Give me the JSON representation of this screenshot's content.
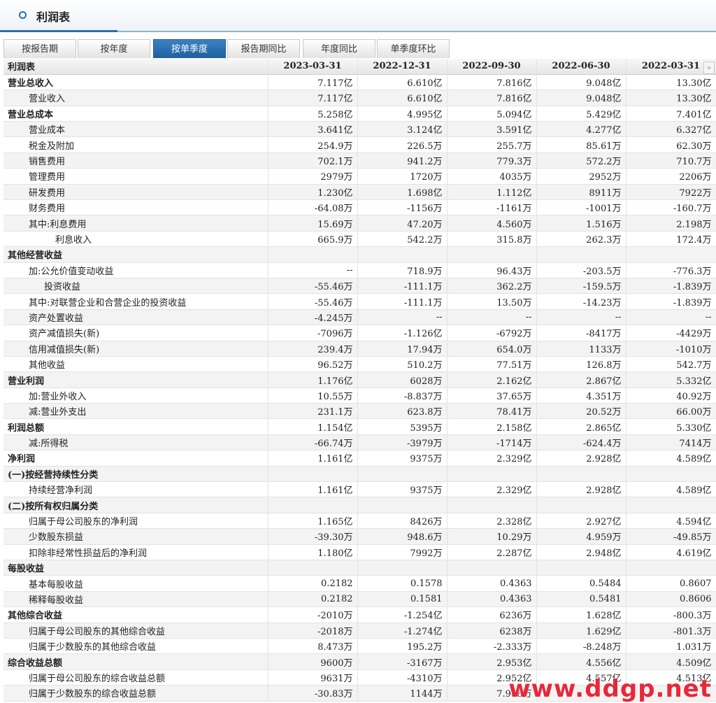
{
  "header": {
    "title": "利润表"
  },
  "tabs": [
    "按报告期",
    "按年度",
    "按单季度",
    "报告期同比",
    "年度同比",
    "单季度环比"
  ],
  "active_tab": 2,
  "columns": [
    "利润表",
    "2023-03-31",
    "2022-12-31",
    "2022-09-30",
    "2022-06-30",
    "2022-03-31"
  ],
  "rows": [
    {
      "label": "营业总收入",
      "level": 0,
      "values": [
        "7.117亿",
        "6.610亿",
        "7.816亿",
        "9.048亿",
        "13.30亿"
      ]
    },
    {
      "label": "营业收入",
      "level": 1,
      "values": [
        "7.117亿",
        "6.610亿",
        "7.816亿",
        "9.048亿",
        "13.30亿"
      ]
    },
    {
      "label": "营业总成本",
      "level": 0,
      "values": [
        "5.258亿",
        "4.995亿",
        "5.094亿",
        "5.429亿",
        "7.401亿"
      ]
    },
    {
      "label": "营业成本",
      "level": 1,
      "values": [
        "3.641亿",
        "3.124亿",
        "3.591亿",
        "4.277亿",
        "6.327亿"
      ]
    },
    {
      "label": "税金及附加",
      "level": 1,
      "values": [
        "254.9万",
        "226.5万",
        "255.7万",
        "85.61万",
        "62.30万"
      ]
    },
    {
      "label": "销售费用",
      "level": 1,
      "values": [
        "702.1万",
        "941.2万",
        "779.3万",
        "572.2万",
        "710.7万"
      ]
    },
    {
      "label": "管理费用",
      "level": 1,
      "values": [
        "2979万",
        "1720万",
        "4035万",
        "2952万",
        "2206万"
      ]
    },
    {
      "label": "研发费用",
      "level": 1,
      "values": [
        "1.230亿",
        "1.698亿",
        "1.112亿",
        "8911万",
        "7922万"
      ]
    },
    {
      "label": "财务费用",
      "level": 1,
      "values": [
        "-64.08万",
        "-1156万",
        "-1161万",
        "-1001万",
        "-160.7万"
      ]
    },
    {
      "label": "其中:利息费用",
      "level": 1,
      "values": [
        "15.69万",
        "47.20万",
        "4.560万",
        "1.516万",
        "2.198万"
      ]
    },
    {
      "label": "利息收入",
      "level": 3,
      "values": [
        "665.9万",
        "542.2万",
        "315.8万",
        "262.3万",
        "172.4万"
      ]
    },
    {
      "label": "其他经营收益",
      "level": 0,
      "values": [
        "",
        "",
        "",
        "",
        ""
      ]
    },
    {
      "label": "加:公允价值变动收益",
      "level": 1,
      "values": [
        "--",
        "718.9万",
        "96.43万",
        "-203.5万",
        "-776.3万"
      ]
    },
    {
      "label": "投资收益",
      "level": 2,
      "values": [
        "-55.46万",
        "-111.1万",
        "362.2万",
        "-159.5万",
        "-1.839万"
      ]
    },
    {
      "label": "其中:对联营企业和合营企业的投资收益",
      "level": 1,
      "values": [
        "-55.46万",
        "-111.1万",
        "13.50万",
        "-14.23万",
        "-1.839万"
      ]
    },
    {
      "label": "资产处置收益",
      "level": 1,
      "values": [
        "-4.245万",
        "--",
        "--",
        "--",
        "--"
      ]
    },
    {
      "label": "资产减值损失(新)",
      "level": 1,
      "values": [
        "-7096万",
        "-1.126亿",
        "-6792万",
        "-8417万",
        "-4429万"
      ]
    },
    {
      "label": "信用减值损失(新)",
      "level": 1,
      "values": [
        "239.4万",
        "17.94万",
        "654.0万",
        "1133万",
        "-1010万"
      ]
    },
    {
      "label": "其他收益",
      "level": 1,
      "values": [
        "96.52万",
        "510.2万",
        "77.51万",
        "126.8万",
        "542.7万"
      ]
    },
    {
      "label": "营业利润",
      "level": 0,
      "values": [
        "1.176亿",
        "6028万",
        "2.162亿",
        "2.867亿",
        "5.332亿"
      ]
    },
    {
      "label": "加:营业外收入",
      "level": 1,
      "values": [
        "10.55万",
        "-8.837万",
        "37.65万",
        "4.351万",
        "40.92万"
      ]
    },
    {
      "label": "减:营业外支出",
      "level": 1,
      "values": [
        "231.1万",
        "623.8万",
        "78.41万",
        "20.52万",
        "66.00万"
      ]
    },
    {
      "label": "利润总额",
      "level": 0,
      "values": [
        "1.154亿",
        "5395万",
        "2.158亿",
        "2.865亿",
        "5.330亿"
      ]
    },
    {
      "label": "减:所得税",
      "level": 1,
      "values": [
        "-66.74万",
        "-3979万",
        "-1714万",
        "-624.4万",
        "7414万"
      ]
    },
    {
      "label": "净利润",
      "level": 0,
      "values": [
        "1.161亿",
        "9375万",
        "2.329亿",
        "2.928亿",
        "4.589亿"
      ]
    },
    {
      "label": "(一)按经营持续性分类",
      "level": 0,
      "values": [
        "",
        "",
        "",
        "",
        ""
      ]
    },
    {
      "label": "持续经营净利润",
      "level": 1,
      "values": [
        "1.161亿",
        "9375万",
        "2.329亿",
        "2.928亿",
        "4.589亿"
      ]
    },
    {
      "label": "(二)按所有权归属分类",
      "level": 0,
      "values": [
        "",
        "",
        "",
        "",
        ""
      ]
    },
    {
      "label": "归属于母公司股东的净利润",
      "level": 1,
      "values": [
        "1.165亿",
        "8426万",
        "2.328亿",
        "2.927亿",
        "4.594亿"
      ]
    },
    {
      "label": "少数股东损益",
      "level": 1,
      "values": [
        "-39.30万",
        "948.6万",
        "10.29万",
        "4.959万",
        "-49.85万"
      ]
    },
    {
      "label": "扣除非经常性损益后的净利润",
      "level": 1,
      "values": [
        "1.180亿",
        "7992万",
        "2.287亿",
        "2.948亿",
        "4.619亿"
      ]
    },
    {
      "label": "每股收益",
      "level": 0,
      "values": [
        "",
        "",
        "",
        "",
        ""
      ]
    },
    {
      "label": "基本每股收益",
      "level": 1,
      "values": [
        "0.2182",
        "0.1578",
        "0.4363",
        "0.5484",
        "0.8607"
      ]
    },
    {
      "label": "稀释每股收益",
      "level": 1,
      "values": [
        "0.2182",
        "0.1581",
        "0.4363",
        "0.5481",
        "0.8606"
      ]
    },
    {
      "label": "其他综合收益",
      "level": 0,
      "values": [
        "-2010万",
        "-1.254亿",
        "6236万",
        "1.628亿",
        "-800.3万"
      ]
    },
    {
      "label": "归属于母公司股东的其他综合收益",
      "level": 1,
      "values": [
        "-2018万",
        "-1.274亿",
        "6238万",
        "1.629亿",
        "-801.3万"
      ]
    },
    {
      "label": "归属于少数股东的其他综合收益",
      "level": 1,
      "values": [
        "8.473万",
        "195.2万",
        "-2.333万",
        "-8.248万",
        "1.031万"
      ]
    },
    {
      "label": "综合收益总额",
      "level": 0,
      "values": [
        "9600万",
        "-3167万",
        "2.953亿",
        "4.556亿",
        "4.509亿"
      ]
    },
    {
      "label": "归属于母公司股东的综合收益总额",
      "level": 1,
      "values": [
        "9631万",
        "-4310万",
        "2.952亿",
        "4.557亿",
        "4.513亿"
      ]
    },
    {
      "label": "归属于少数股东的综合收益总额",
      "level": 1,
      "values": [
        "-30.83万",
        "1144万",
        "7.958万",
        "",
        ""
      ]
    }
  ],
  "watermark": "www.ddgp.net"
}
